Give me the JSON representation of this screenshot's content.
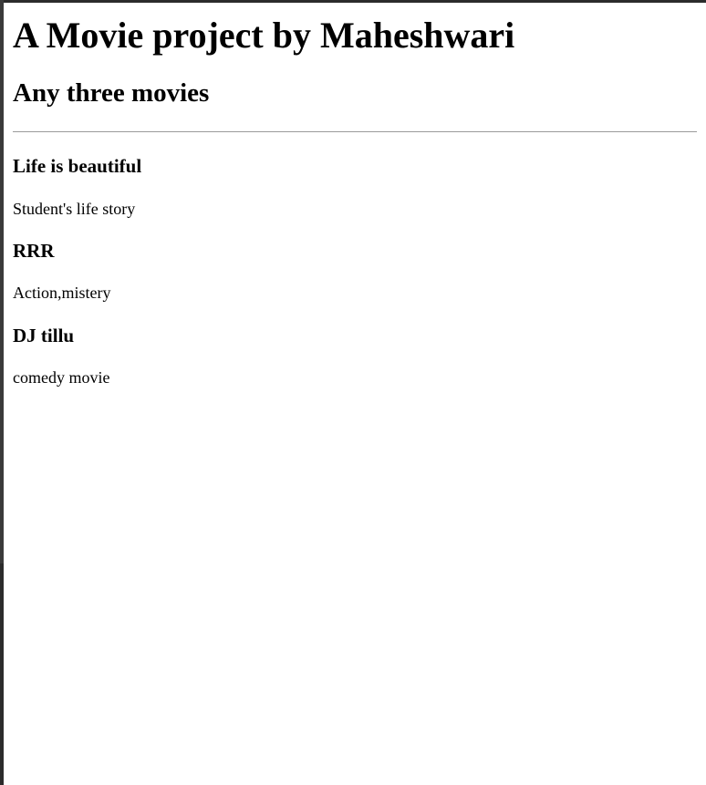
{
  "page": {
    "heading": "A Movie project by Maheshwari",
    "subheading": "Any three movies"
  },
  "movies": [
    {
      "title": "Life is beautiful",
      "description": "Student's life story"
    },
    {
      "title": "RRR",
      "description": "Action,mistery"
    },
    {
      "title": "DJ tillu",
      "description": "comedy movie"
    }
  ],
  "colors": {
    "text": "#000000",
    "background": "#ffffff",
    "divider": "#9a9a9a",
    "frame": "#2b2b2b"
  }
}
